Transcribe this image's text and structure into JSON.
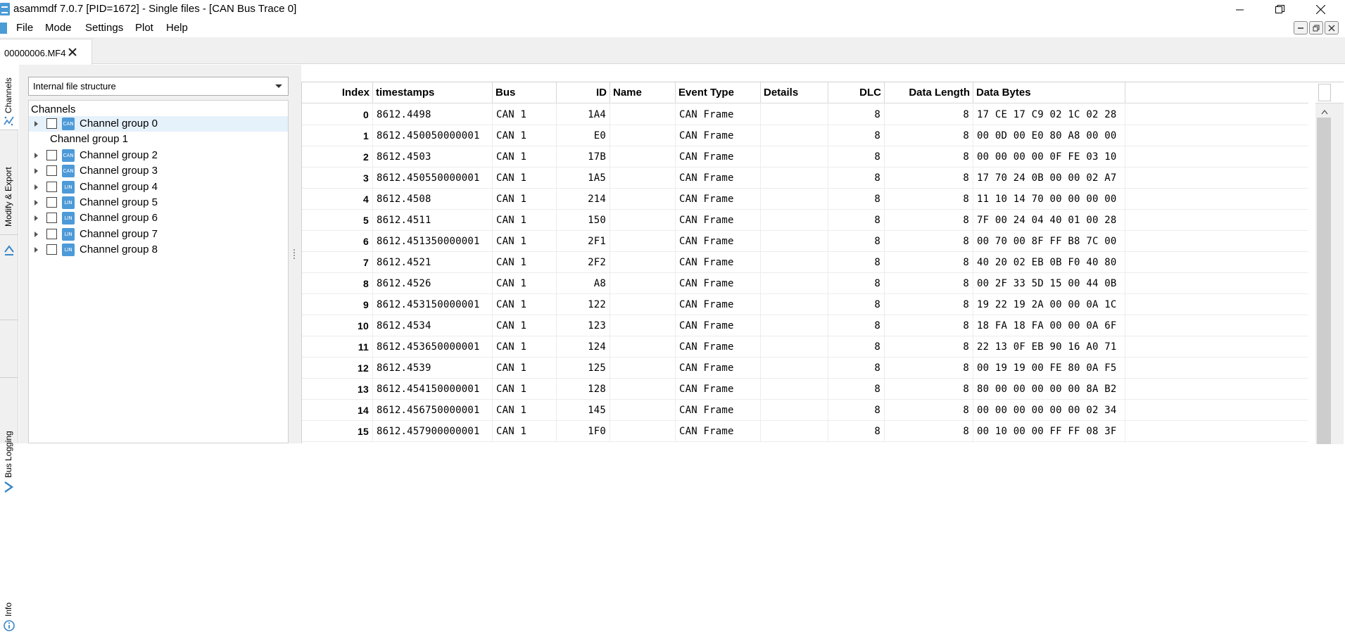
{
  "window": {
    "title": "asammdf 7.0.7 [PID=1672] - Single files - [CAN Bus Trace 0]"
  },
  "menu": [
    "File",
    "Mode",
    "Settings",
    "Plot",
    "Help"
  ],
  "file_tab": {
    "label": "00000006.MF4"
  },
  "side_tabs": [
    "Channels",
    "Modify & Export",
    "Bus Logging",
    "Info"
  ],
  "file_view": {
    "selected": "Internal file structure"
  },
  "channel_tree": {
    "header": "Channels",
    "groups": [
      {
        "label": "Channel group 0",
        "expandable": true,
        "checkbox": true,
        "icon": "CAN",
        "selected": true
      },
      {
        "label": "Channel group 1",
        "expandable": false,
        "checkbox": false,
        "icon": "",
        "selected": false
      },
      {
        "label": "Channel group 2",
        "expandable": true,
        "checkbox": true,
        "icon": "CAN",
        "selected": false
      },
      {
        "label": "Channel group 3",
        "expandable": true,
        "checkbox": true,
        "icon": "CAN",
        "selected": false
      },
      {
        "label": "Channel group 4",
        "expandable": true,
        "checkbox": true,
        "icon": "LIN",
        "selected": false
      },
      {
        "label": "Channel group 5",
        "expandable": true,
        "checkbox": true,
        "icon": "LIN",
        "selected": false
      },
      {
        "label": "Channel group 6",
        "expandable": true,
        "checkbox": true,
        "icon": "LIN",
        "selected": false
      },
      {
        "label": "Channel group 7",
        "expandable": true,
        "checkbox": true,
        "icon": "LIN",
        "selected": false
      },
      {
        "label": "Channel group 8",
        "expandable": true,
        "checkbox": true,
        "icon": "LIN",
        "selected": false
      }
    ]
  },
  "table": {
    "columns": [
      "Index",
      "timestamps",
      "Bus",
      "ID",
      "Name",
      "Event Type",
      "Details",
      "DLC",
      "Data Length",
      "Data Bytes"
    ],
    "rows": [
      [
        "0",
        "8612.4498",
        "CAN 1",
        "1A4",
        "",
        "CAN Frame",
        "",
        "8",
        "8",
        "17 CE 17 C9 02 1C 02 28"
      ],
      [
        "1",
        "8612.450050000001",
        "CAN 1",
        "E0",
        "",
        "CAN Frame",
        "",
        "8",
        "8",
        "00 0D 00 E0 80 A8 00 00"
      ],
      [
        "2",
        "8612.4503",
        "CAN 1",
        "17B",
        "",
        "CAN Frame",
        "",
        "8",
        "8",
        "00 00 00 00 0F FE 03 10"
      ],
      [
        "3",
        "8612.450550000001",
        "CAN 1",
        "1A5",
        "",
        "CAN Frame",
        "",
        "8",
        "8",
        "17 70 24 0B 00 00 02 A7"
      ],
      [
        "4",
        "8612.4508",
        "CAN 1",
        "214",
        "",
        "CAN Frame",
        "",
        "8",
        "8",
        "11 10 14 70 00 00 00 00"
      ],
      [
        "5",
        "8612.4511",
        "CAN 1",
        "150",
        "",
        "CAN Frame",
        "",
        "8",
        "8",
        "7F 00 24 04 40 01 00 28"
      ],
      [
        "6",
        "8612.451350000001",
        "CAN 1",
        "2F1",
        "",
        "CAN Frame",
        "",
        "8",
        "8",
        "00 70 00 8F FF B8 7C 00"
      ],
      [
        "7",
        "8612.4521",
        "CAN 1",
        "2F2",
        "",
        "CAN Frame",
        "",
        "8",
        "8",
        "40 20 02 EB 0B F0 40 80"
      ],
      [
        "8",
        "8612.4526",
        "CAN 1",
        "A8",
        "",
        "CAN Frame",
        "",
        "8",
        "8",
        "00 2F 33 5D 15 00 44 0B"
      ],
      [
        "9",
        "8612.453150000001",
        "CAN 1",
        "122",
        "",
        "CAN Frame",
        "",
        "8",
        "8",
        "19 22 19 2A 00 00 0A 1C"
      ],
      [
        "10",
        "8612.4534",
        "CAN 1",
        "123",
        "",
        "CAN Frame",
        "",
        "8",
        "8",
        "18 FA 18 FA 00 00 0A 6F"
      ],
      [
        "11",
        "8612.453650000001",
        "CAN 1",
        "124",
        "",
        "CAN Frame",
        "",
        "8",
        "8",
        "22 13 0F EB 90 16 A0 71"
      ],
      [
        "12",
        "8612.4539",
        "CAN 1",
        "125",
        "",
        "CAN Frame",
        "",
        "8",
        "8",
        "00 19 19 00 FE 80 0A F5"
      ],
      [
        "13",
        "8612.454150000001",
        "CAN 1",
        "128",
        "",
        "CAN Frame",
        "",
        "8",
        "8",
        "80 00 00 00 00 00 8A B2"
      ],
      [
        "14",
        "8612.456750000001",
        "CAN 1",
        "145",
        "",
        "CAN Frame",
        "",
        "8",
        "8",
        "00 00 00 00 00 00 02 34"
      ],
      [
        "15",
        "8612.457900000001",
        "CAN 1",
        "1F0",
        "",
        "CAN Frame",
        "",
        "8",
        "8",
        "00 10 00 00 FF FF 08 3F"
      ]
    ]
  },
  "colors": {
    "accent": "#4d9ad8",
    "selection": "#e5f1fb",
    "panel_bg": "#f0f0f0"
  }
}
